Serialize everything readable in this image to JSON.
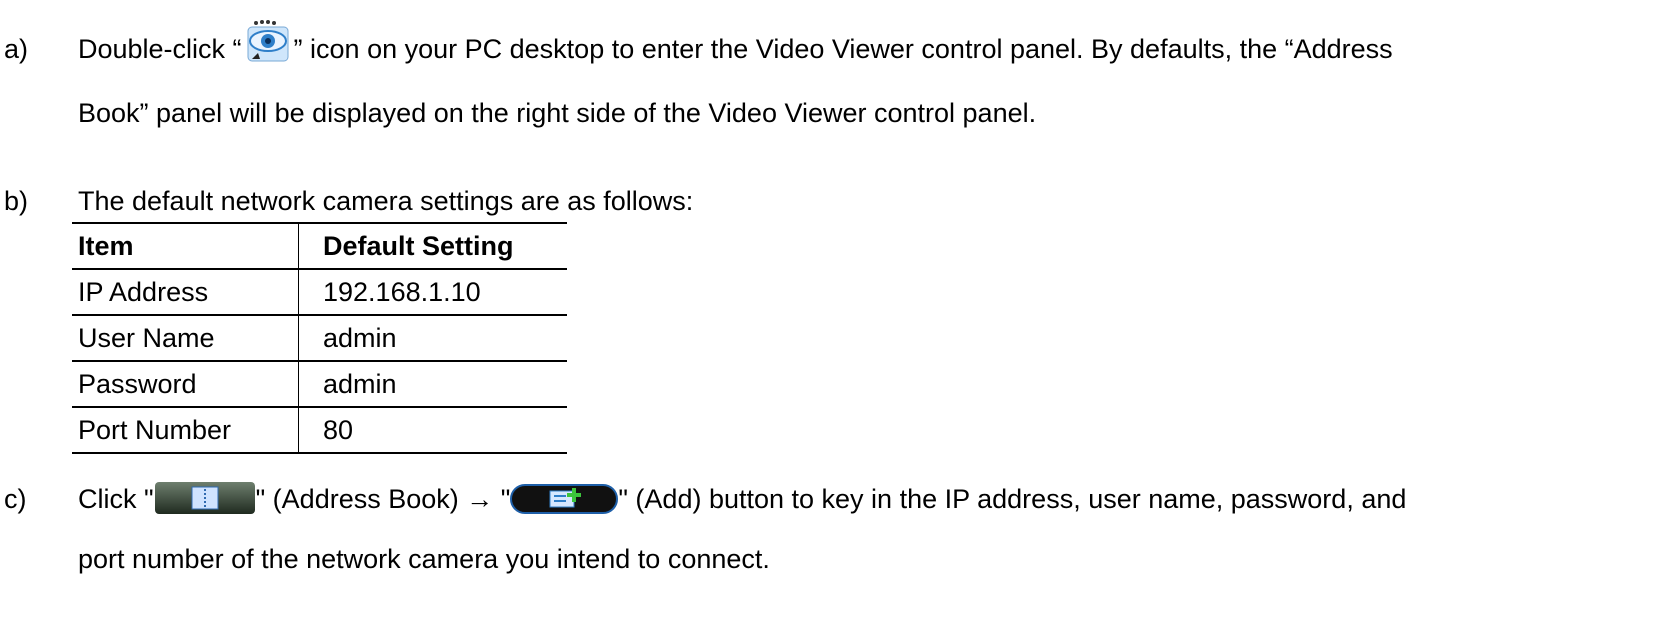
{
  "step_a": {
    "marker": "a)",
    "before_icon": "Double-click “",
    "icon": "video-viewer-icon",
    "after_icon": "” icon on your PC desktop to enter the Video Viewer control panel. By defaults, the “Address",
    "line2": "Book” panel will be displayed on the right side of the Video Viewer control panel."
  },
  "step_b": {
    "marker": "b)",
    "text": "The default network camera settings are as follows:",
    "table": {
      "headers": [
        "Item",
        "Default Setting"
      ],
      "rows": [
        [
          "IP Address",
          "192.168.1.10"
        ],
        [
          "User Name",
          "admin"
        ],
        [
          "Password",
          "admin"
        ],
        [
          "Port Number",
          "80"
        ]
      ]
    }
  },
  "step_c": {
    "marker": "c)",
    "click": "Click \"",
    "address_book_icon": "address-book-icon",
    "mid": "\" (Address Book) → \"",
    "add_icon": "add-button-icon",
    "after": "\" (Add) button to key in the IP address, user name, password, and",
    "line2": "port number of the network camera you intend to connect."
  },
  "colors": {
    "text": "#000000",
    "icon_blue": "#2f7fc9",
    "icon_green": "#3cc43c"
  }
}
